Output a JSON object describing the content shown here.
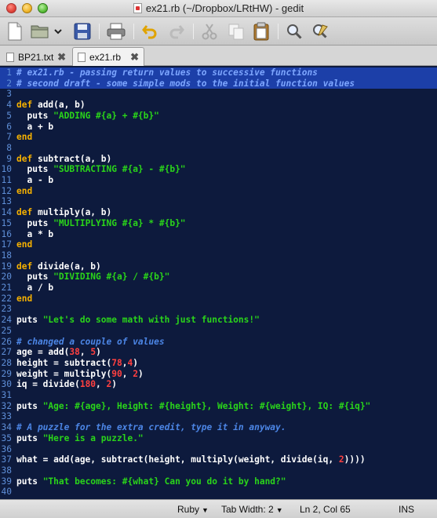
{
  "window": {
    "title": "ex21.rb (~/Dropbox/LRtHW) - gedit"
  },
  "toolbar": {
    "buttons": [
      "new-document",
      "open",
      "open-dropdown",
      "save",
      "print",
      "undo",
      "redo",
      "cut",
      "copy",
      "paste",
      "find",
      "find-replace"
    ]
  },
  "tabs": [
    {
      "label": "BP21.txt",
      "active": false
    },
    {
      "label": "ex21.rb",
      "active": true
    }
  ],
  "editor": {
    "highlighted_lines": [
      1,
      2
    ],
    "lines": [
      {
        "n": "1",
        "html": "<span class=\"cm hl2\"># ex21.rb - passing return values to successive functions</span>"
      },
      {
        "n": "2",
        "html": "<span class=\"cm hl2\"># second draft - some simple mods to the initial function values</span>"
      },
      {
        "n": "3",
        "html": ""
      },
      {
        "n": "4",
        "html": "<span class=\"kw\">def</span> add(a, b)"
      },
      {
        "n": "5",
        "html": "  puts <span class=\"str\">\"ADDING #{a} + #{b}\"</span>"
      },
      {
        "n": "6",
        "html": "  a + b"
      },
      {
        "n": "7",
        "html": "<span class=\"kw\">end</span>"
      },
      {
        "n": "8",
        "html": ""
      },
      {
        "n": "9",
        "html": "<span class=\"kw\">def</span> subtract(a, b)"
      },
      {
        "n": "10",
        "html": "  puts <span class=\"str\">\"SUBTRACTING #{a} - #{b}\"</span>"
      },
      {
        "n": "11",
        "html": "  a - b"
      },
      {
        "n": "12",
        "html": "<span class=\"kw\">end</span>"
      },
      {
        "n": "13",
        "html": ""
      },
      {
        "n": "14",
        "html": "<span class=\"kw\">def</span> multiply(a, b)"
      },
      {
        "n": "15",
        "html": "  puts <span class=\"str\">\"MULTIPLYING #{a} * #{b}\"</span>"
      },
      {
        "n": "16",
        "html": "  a * b"
      },
      {
        "n": "17",
        "html": "<span class=\"kw\">end</span>"
      },
      {
        "n": "18",
        "html": ""
      },
      {
        "n": "19",
        "html": "<span class=\"kw\">def</span> divide(a, b)"
      },
      {
        "n": "20",
        "html": "  puts <span class=\"str\">\"DIVIDING #{a} / #{b}\"</span>"
      },
      {
        "n": "21",
        "html": "  a / b"
      },
      {
        "n": "22",
        "html": "<span class=\"kw\">end</span>"
      },
      {
        "n": "23",
        "html": ""
      },
      {
        "n": "24",
        "html": "puts <span class=\"str\">\"Let's do some math with just functions!\"</span>"
      },
      {
        "n": "25",
        "html": ""
      },
      {
        "n": "26",
        "html": "<span class=\"cm\"># changed a couple of values</span>"
      },
      {
        "n": "27",
        "html": "age = add(<span class=\"num\">38</span>, <span class=\"num\">5</span>)"
      },
      {
        "n": "28",
        "html": "height = subtract(<span class=\"num\">78</span>,<span class=\"num\">4</span>)"
      },
      {
        "n": "29",
        "html": "weight = multiply(<span class=\"num\">90</span>, <span class=\"num\">2</span>)"
      },
      {
        "n": "30",
        "html": "iq = divide(<span class=\"num\">180</span>, <span class=\"num\">2</span>)"
      },
      {
        "n": "31",
        "html": ""
      },
      {
        "n": "32",
        "html": "puts <span class=\"str\">\"Age: #{age}, Height: #{height}, Weight: #{weight}, IQ: #{iq}\"</span>"
      },
      {
        "n": "33",
        "html": ""
      },
      {
        "n": "34",
        "html": "<span class=\"cm\"># A puzzle for the extra credit, type it in anyway.</span>"
      },
      {
        "n": "35",
        "html": "puts <span class=\"str\">\"Here is a puzzle.\"</span>"
      },
      {
        "n": "36",
        "html": ""
      },
      {
        "n": "37",
        "html": "what = add(age, subtract(height, multiply(weight, divide(iq, <span class=\"num\">2</span>))))"
      },
      {
        "n": "38",
        "html": ""
      },
      {
        "n": "39",
        "html": "puts <span class=\"str\">\"That becomes: #{what} Can you do it by hand?\"</span>"
      },
      {
        "n": "40",
        "html": ""
      }
    ]
  },
  "status": {
    "language": "Ruby",
    "tab_width": "Tab Width:  2",
    "cursor": "Ln 2, Col 65",
    "mode": "INS"
  }
}
